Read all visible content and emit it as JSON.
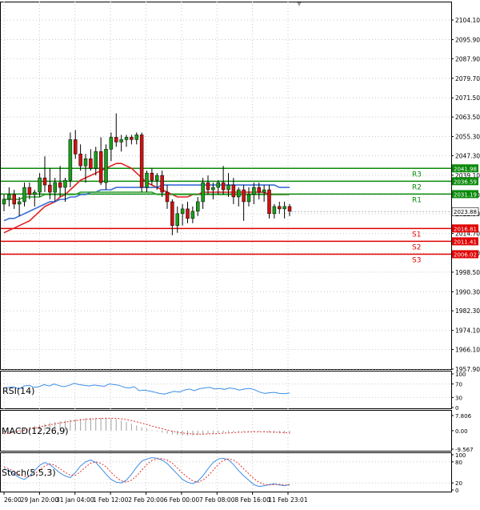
{
  "top_marker": "▼",
  "colors": {
    "background": "#ffffff",
    "frame": "#000000",
    "grid": "#c8c8c8",
    "bull": "#1a9e1a",
    "bear": "#d01010",
    "resistance": "#0a8a0a",
    "support": "#e00000",
    "ma_red": "#e02020",
    "ma_blue": "#3a6fd8",
    "ma_green": "#2ca02c",
    "rsi_line": "#3c8de8",
    "macd_hist": "#a0a0a0",
    "macd_signal": "#e03030",
    "stoch_main": "#3c8de8",
    "stoch_signal": "#e03030",
    "price_tag": "#ffffff"
  },
  "chart_data": [
    {
      "type": "candlestick",
      "panel": "price",
      "y_ticks": [
        "2104.10",
        "2095.90",
        "2087.90",
        "2079.70",
        "2071.50",
        "2063.50",
        "2055.30",
        "2047.30",
        "2039.10",
        "2030.90",
        "2022.90",
        "2014.70",
        "2006.50",
        "1998.50",
        "1990.30",
        "1982.30",
        "1974.10",
        "1966.10",
        "1957.90"
      ],
      "ylim": [
        1957.9,
        2104.1
      ],
      "x_ticks": [
        "26:00",
        "29 Jan 20:00",
        "31 Jan 04:00",
        "1 Feb 12:00",
        "2 Feb 20:00",
        "6 Feb 00:00",
        "7 Feb 08:00",
        "8 Feb 16:00",
        "11 Feb 23:01"
      ],
      "current_price": 2023.88,
      "candles": [
        [
          2027,
          2031,
          2024,
          2029
        ],
        [
          2029,
          2034,
          2026,
          2031
        ],
        [
          2031,
          2033,
          2025,
          2027
        ],
        [
          2027,
          2030,
          2022,
          2028
        ],
        [
          2028,
          2036,
          2026,
          2034
        ],
        [
          2034,
          2036,
          2029,
          2031
        ],
        [
          2031,
          2033,
          2026,
          2032
        ],
        [
          2032,
          2040,
          2030,
          2038
        ],
        [
          2038,
          2047,
          2032,
          2035
        ],
        [
          2035,
          2042,
          2029,
          2032
        ],
        [
          2032,
          2038,
          2028,
          2036
        ],
        [
          2036,
          2043,
          2030,
          2034
        ],
        [
          2034,
          2038,
          2028,
          2037
        ],
        [
          2037,
          2057,
          2034,
          2054
        ],
        [
          2054,
          2058,
          2046,
          2048
        ],
        [
          2048,
          2052,
          2041,
          2043
        ],
        [
          2043,
          2048,
          2036,
          2046
        ],
        [
          2046,
          2050,
          2041,
          2042
        ],
        [
          2042,
          2051,
          2039,
          2049
        ],
        [
          2049,
          2055,
          2035,
          2036
        ],
        [
          2036,
          2052,
          2033,
          2050
        ],
        [
          2050,
          2057,
          2045,
          2055
        ],
        [
          2055,
          2065,
          2051,
          2053
        ],
        [
          2053,
          2056,
          2049,
          2054
        ],
        [
          2054,
          2056,
          2051,
          2055
        ],
        [
          2055,
          2056,
          2052,
          2054
        ],
        [
          2054,
          2057,
          2052,
          2056
        ],
        [
          2056,
          2057,
          2032,
          2034
        ],
        [
          2034,
          2041,
          2032,
          2040
        ],
        [
          2040,
          2042,
          2035,
          2037
        ],
        [
          2037,
          2040,
          2033,
          2039
        ],
        [
          2039,
          2041,
          2030,
          2032
        ],
        [
          2032,
          2035,
          2025,
          2028
        ],
        [
          2028,
          2029,
          2014,
          2018
        ],
        [
          2018,
          2026,
          2015,
          2023
        ],
        [
          2023,
          2027,
          2018,
          2025
        ],
        [
          2025,
          2028,
          2019,
          2021
        ],
        [
          2021,
          2026,
          2019,
          2024
        ],
        [
          2024,
          2030,
          2022,
          2028
        ],
        [
          2028,
          2038,
          2025,
          2036
        ],
        [
          2036,
          2039,
          2031,
          2033
        ],
        [
          2033,
          2036,
          2029,
          2034
        ],
        [
          2034,
          2037,
          2031,
          2036
        ],
        [
          2036,
          2043,
          2031,
          2033
        ],
        [
          2033,
          2040,
          2030,
          2035
        ],
        [
          2035,
          2038,
          2027,
          2030
        ],
        [
          2030,
          2034,
          2026,
          2033
        ],
        [
          2033,
          2035,
          2020,
          2028
        ],
        [
          2028,
          2034,
          2026,
          2031
        ],
        [
          2031,
          2036,
          2027,
          2034
        ],
        [
          2034,
          2036,
          2029,
          2032
        ],
        [
          2032,
          2035,
          2028,
          2033
        ],
        [
          2033,
          2035,
          2021,
          2023
        ],
        [
          2023,
          2027,
          2021,
          2026
        ],
        [
          2026,
          2028,
          2023,
          2025
        ],
        [
          2025,
          2028,
          2021,
          2026
        ],
        [
          2026,
          2027,
          2022,
          2024
        ]
      ],
      "moving_averages": [
        {
          "color_key": "ma_red",
          "values": [
            2015,
            2016,
            2017,
            2018,
            2019,
            2020,
            2022,
            2024,
            2026,
            2027,
            2028,
            2030,
            2031,
            2033,
            2035,
            2037,
            2038,
            2039,
            2040,
            2041,
            2042,
            2043,
            2044,
            2044,
            2043,
            2042,
            2040,
            2038,
            2036,
            2035,
            2034,
            2033,
            2032,
            2031,
            2030,
            2030,
            2030,
            2031,
            2031,
            2032,
            2032,
            2032,
            2032,
            2032,
            2032,
            2032,
            2032,
            2032,
            2032,
            2032,
            2032,
            2032,
            2031,
            2031,
            2031,
            2031,
            2031
          ]
        },
        {
          "color_key": "ma_blue",
          "values": [
            2020,
            2021,
            2021,
            2022,
            2023,
            2024,
            2025,
            2026,
            2027,
            2028,
            2028,
            2029,
            2029,
            2030,
            2030,
            2031,
            2031,
            2032,
            2032,
            2033,
            2033,
            2033,
            2034,
            2034,
            2034,
            2034,
            2034,
            2034,
            2034,
            2034,
            2034,
            2035,
            2035,
            2035,
            2035,
            2035,
            2035,
            2035,
            2035,
            2035,
            2035,
            2035,
            2035,
            2035,
            2035,
            2035,
            2035,
            2035,
            2035,
            2035,
            2035,
            2035,
            2035,
            2035,
            2034,
            2034,
            2034
          ]
        },
        {
          "color_key": "ma_green",
          "values": [
            2029,
            2029,
            2029,
            2029,
            2030,
            2030,
            2030,
            2030,
            2031,
            2031,
            2031,
            2031,
            2031,
            2031,
            2031,
            2032,
            2032,
            2032,
            2032,
            2032,
            2032,
            2032,
            2032,
            2032,
            2032,
            2032,
            2032,
            2032,
            2032,
            2032,
            2031,
            2031,
            2031,
            2031,
            2031,
            2031,
            2031,
            2031,
            2031,
            2031,
            2031,
            2031,
            2031,
            2031,
            2031,
            2031,
            2031,
            2031,
            2031,
            2031,
            2031,
            2031,
            2031,
            2031,
            2031,
            2031,
            2031
          ]
        }
      ],
      "levels": [
        {
          "name": "R3",
          "value": 2041.98,
          "tag": "2041.98",
          "kind": "resistance"
        },
        {
          "name": "R2",
          "value": 2036.59,
          "tag": "2036.59",
          "kind": "resistance"
        },
        {
          "name": "R1",
          "value": 2031.19,
          "tag": "2031.19",
          "kind": "resistance"
        },
        {
          "name": "S1",
          "value": 2016.81,
          "tag": "2016.81",
          "kind": "support"
        },
        {
          "name": "S2",
          "value": 2011.41,
          "tag": "2011.41",
          "kind": "support"
        },
        {
          "name": "S3",
          "value": 2006.02,
          "tag": "2006.02",
          "kind": "support"
        }
      ]
    },
    {
      "type": "line",
      "panel": "rsi",
      "label": "RSI(14)",
      "y_ticks": [
        "100",
        "70",
        "30",
        "0"
      ],
      "ylim": [
        0,
        100
      ],
      "values": [
        58,
        60,
        61,
        55,
        64,
        66,
        60,
        62,
        68,
        64,
        70,
        65,
        62,
        66,
        72,
        68,
        66,
        64,
        67,
        65,
        63,
        70,
        68,
        66,
        60,
        58,
        62,
        50,
        52,
        49,
        46,
        42,
        40,
        44,
        48,
        46,
        52,
        55,
        50,
        56,
        58,
        60,
        55,
        57,
        54,
        58,
        56,
        52,
        55,
        57,
        53,
        46,
        42,
        44,
        45,
        42,
        41,
        43
      ]
    },
    {
      "type": "histogram+line",
      "panel": "macd",
      "label": "MACD(12,26,9)",
      "y_ticks": [
        "7.806",
        "0.00",
        "-9.567"
      ],
      "ylim": [
        -9.567,
        7.806
      ],
      "histogram": [
        -1.0,
        -0.5,
        0.2,
        0.8,
        1.2,
        1.8,
        2.4,
        3.0,
        3.5,
        4.0,
        4.4,
        4.8,
        5.2,
        5.6,
        5.9,
        6.2,
        6.4,
        6.5,
        6.6,
        6.6,
        6.5,
        6.2,
        5.8,
        5.2,
        4.5,
        3.6,
        2.7,
        1.8,
        1.0,
        0.3,
        -0.4,
        -1.0,
        -1.6,
        -2.0,
        -2.3,
        -2.5,
        -2.6,
        -2.5,
        -2.3,
        -2.0,
        -1.7,
        -1.4,
        -1.2,
        -1.0,
        -0.8,
        -0.7,
        -0.6,
        -0.6,
        -0.5,
        -0.5,
        -0.6,
        -0.8,
        -1.0,
        -1.2,
        -1.4,
        -1.5,
        -1.6
      ],
      "signal": [
        -1.5,
        -1.2,
        -0.8,
        -0.3,
        0.2,
        0.7,
        1.3,
        1.9,
        2.5,
        3.0,
        3.5,
        4.0,
        4.4,
        4.8,
        5.2,
        5.5,
        5.8,
        6.0,
        6.2,
        6.3,
        6.4,
        6.4,
        6.3,
        6.1,
        5.7,
        5.2,
        4.6,
        3.9,
        3.2,
        2.4,
        1.7,
        1.0,
        0.3,
        -0.3,
        -0.8,
        -1.2,
        -1.5,
        -1.7,
        -1.8,
        -1.8,
        -1.7,
        -1.6,
        -1.5,
        -1.3,
        -1.2,
        -1.0,
        -0.9,
        -0.8,
        -0.7,
        -0.6,
        -0.6,
        -0.6,
        -0.7,
        -0.8,
        -0.9,
        -1.0,
        -1.1
      ]
    },
    {
      "type": "line",
      "panel": "stoch",
      "label": "Stoch(5,5,3)",
      "y_ticks": [
        "100",
        "80",
        "20",
        "0"
      ],
      "ylim": [
        0,
        100
      ],
      "main": [
        60,
        55,
        45,
        35,
        30,
        40,
        55,
        70,
        78,
        72,
        60,
        48,
        40,
        35,
        50,
        68,
        80,
        85,
        78,
        62,
        45,
        30,
        22,
        20,
        28,
        45,
        65,
        82,
        88,
        92,
        90,
        85,
        75,
        60,
        45,
        30,
        22,
        18,
        25,
        40,
        60,
        78,
        88,
        90,
        86,
        72,
        55,
        40,
        28,
        15,
        10,
        12,
        15,
        18,
        14,
        12,
        16
      ],
      "signal": [
        65,
        60,
        52,
        44,
        38,
        38,
        45,
        58,
        68,
        74,
        70,
        60,
        50,
        42,
        42,
        52,
        65,
        76,
        80,
        76,
        66,
        50,
        36,
        26,
        22,
        28,
        40,
        56,
        72,
        84,
        88,
        89,
        85,
        76,
        62,
        48,
        36,
        26,
        22,
        28,
        40,
        56,
        72,
        84,
        88,
        85,
        75,
        60,
        46,
        32,
        22,
        16,
        14,
        15,
        16,
        14,
        14
      ]
    }
  ]
}
